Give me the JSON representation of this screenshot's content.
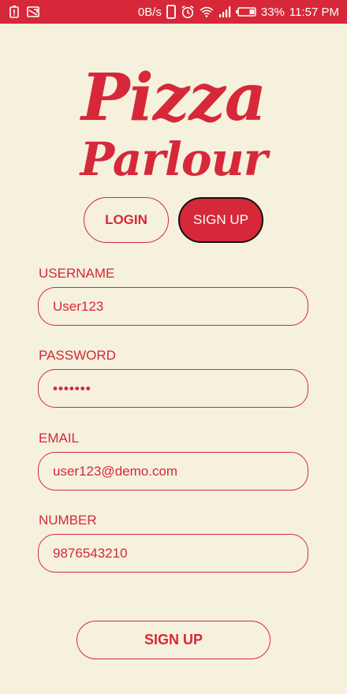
{
  "status_bar": {
    "net_speed": "0B/s",
    "battery": "33%",
    "time": "11:57 PM",
    "color": "#d62839"
  },
  "logo": {
    "line1": "Pizza",
    "line2": "Parlour"
  },
  "tabs": {
    "login": "LOGIN",
    "signup": "SIGN UP",
    "active": "signup"
  },
  "form": {
    "username": {
      "label": "USERNAME",
      "value": "User123"
    },
    "password": {
      "label": "PASSWORD",
      "value": "•••••••"
    },
    "email": {
      "label": "EMAIL",
      "value": "user123@demo.com"
    },
    "number": {
      "label": "NUMBER",
      "value": "9876543210"
    }
  },
  "submit": {
    "label": "SIGN UP"
  },
  "colors": {
    "accent": "#d62839",
    "background": "#f5f1dd"
  }
}
